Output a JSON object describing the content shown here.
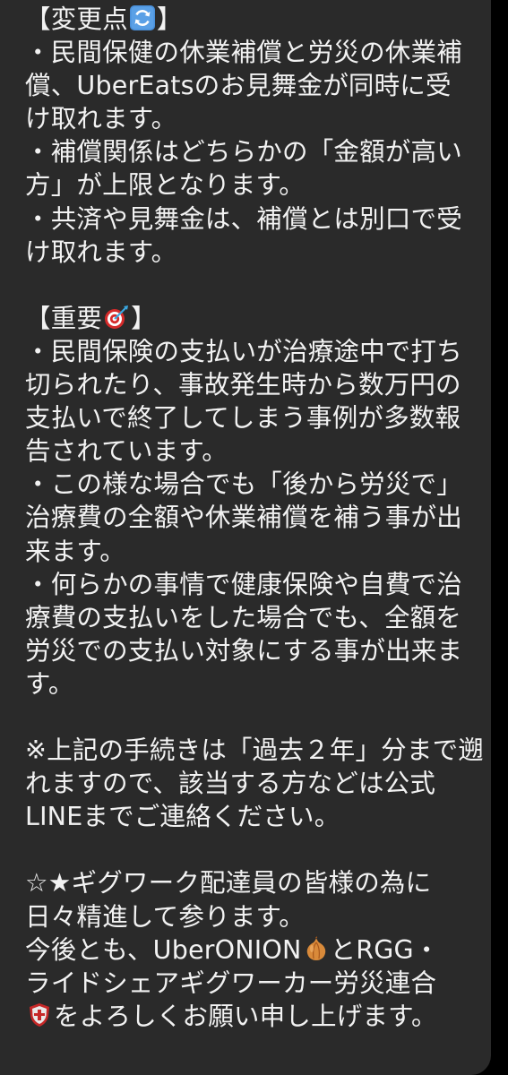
{
  "message": {
    "section1": {
      "heading_prefix": "【変更点",
      "heading_suffix": "】",
      "heading_emoji": "arrows-counterclockwise-icon",
      "lines": [
        "・民間保健の休業補償と労災の休業補",
        "償、UberEatsのお見舞金が同時に受",
        "け取れます。",
        "・補償関係はどちらかの「金額が高い",
        "方」が上限となります。",
        "・共済や見舞金は、補償とは別口で受",
        "け取れます。"
      ]
    },
    "section2": {
      "heading_prefix": "【重要",
      "heading_suffix": "】",
      "heading_emoji": "direct-hit-target-icon",
      "lines": [
        "・民間保険の支払いが治療途中で打ち",
        "切られたり、事故発生時から数万円の",
        "支払いで終了してしまう事例が多数報",
        "告されています。",
        "・この様な場合でも「後から労災で」",
        "治療費の全額や休業補償を補う事が出",
        "来ます。",
        "・何らかの事情で健康保険や自費で治",
        "療費の支払いをした場合でも、全額を",
        "労災での支払い対象にする事が出来ま",
        "す。"
      ]
    },
    "section3": {
      "lines": [
        "※上記の手続きは「過去２年」分まで遡",
        "れますので、該当する方などは公式",
        "LINEまでご連絡ください。"
      ]
    },
    "section4": {
      "line1": "☆★ギグワーク配達員の皆様の為に",
      "line2": "日々精進して参ります。",
      "line3_prefix": "今後とも、UberONION",
      "line3_emoji": "onion-icon",
      "line3_suffix": "とRGG・",
      "line4": "ライドシェアギグワーカー労災連合",
      "line5_emoji": "shield-icon",
      "line5_suffix": "をよろしくお願い申し上げます。"
    }
  },
  "colors": {
    "background": "#000000",
    "bubble": "#2a2a2a",
    "text": "#f2f2f2"
  }
}
